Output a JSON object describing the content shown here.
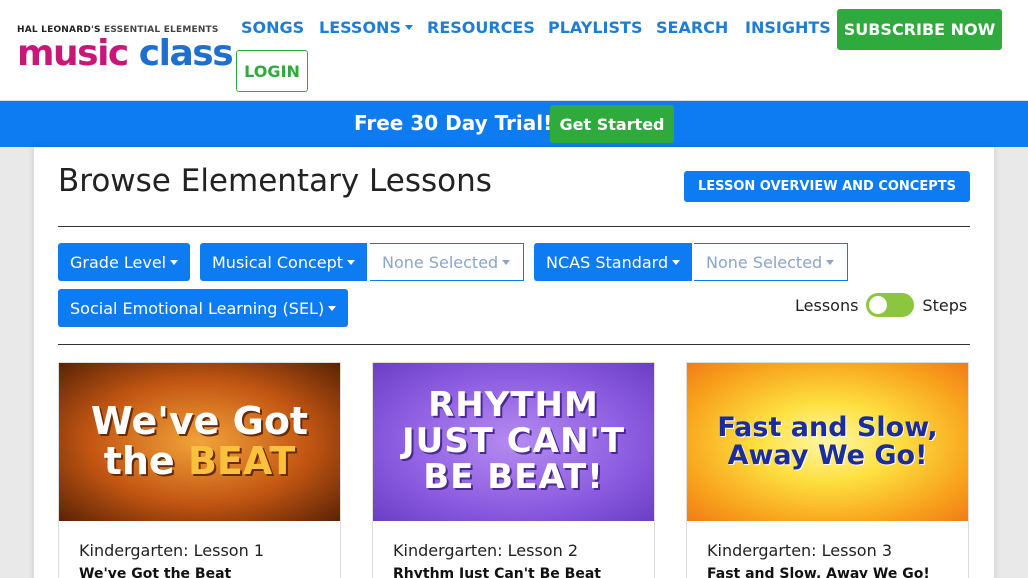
{
  "logo": {
    "top_line_1": "HAL LEONARD'S",
    "top_line_2": "ESSENTIAL ELEMENTS",
    "word_1": "music",
    "word_2": "class"
  },
  "nav": {
    "items": [
      "SONGS",
      "LESSONS",
      "RESOURCES",
      "PLAYLISTS",
      "SEARCH",
      "INSIGHTS"
    ],
    "subscribe_label": "SUBSCRIBE NOW",
    "login_label": "LOGIN"
  },
  "banner": {
    "text": "Free 30 Day Trial!",
    "button_label": "Get Started"
  },
  "page": {
    "title": "Browse Elementary Lessons",
    "overview_button": "LESSON OVERVIEW AND CONCEPTS"
  },
  "filters": {
    "grade_level": "Grade Level",
    "musical_concept": "Musical Concept",
    "musical_concept_value": "None Selected",
    "ncas_standard": "NCAS Standard",
    "ncas_standard_value": "None Selected",
    "sel": "Social Emotional Learning (SEL)"
  },
  "toggle": {
    "left_label": "Lessons",
    "right_label": "Steps",
    "state": "lessons"
  },
  "cards": [
    {
      "thumb_line_1": "We've Got",
      "thumb_line_2a": "the ",
      "thumb_line_2b": "BEAT",
      "meta": "Kindergarten: Lesson 1",
      "title": "We've Got the Beat"
    },
    {
      "thumb_line_1": "RHYTHM",
      "thumb_line_2": "JUST CAN'T",
      "thumb_line_3": "BE BEAT!",
      "meta": "Kindergarten: Lesson 2",
      "title": "Rhythm Just Can't Be Beat"
    },
    {
      "thumb_line_1": "Fast and Slow,",
      "thumb_line_2": "Away We Go!",
      "meta": "Kindergarten: Lesson 3",
      "title": "Fast and Slow, Away We Go!"
    }
  ],
  "colors": {
    "brand_blue": "#0d7cf2",
    "brand_green": "#2eab3c",
    "logo_magenta": "#c8177b",
    "toggle_green": "#8cc63f"
  }
}
